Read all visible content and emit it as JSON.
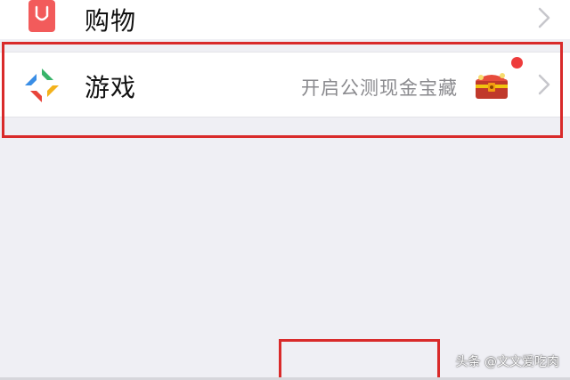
{
  "menu": {
    "shopping": {
      "label": "购物",
      "icon": "shopping-bag-icon"
    },
    "games": {
      "label": "游戏",
      "icon": "games-icon",
      "subtitle": "开启公测现金宝藏",
      "badge_icon": "treasure-chest-icon",
      "has_notification_dot": true
    }
  },
  "watermark": "头条 @文文爱吃肉",
  "colors": {
    "page_background": "#efeff4",
    "row_background": "#ffffff",
    "highlight_box": "#d92a2a",
    "notification_dot": "#ee3c3c",
    "shopping_icon": "#f25b5b"
  }
}
